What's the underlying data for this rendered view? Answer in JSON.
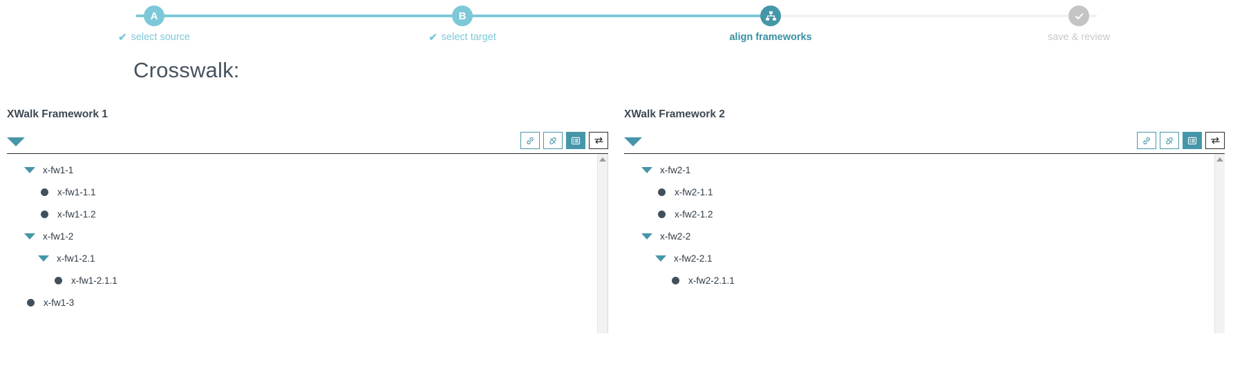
{
  "stepper": {
    "steps": [
      {
        "badge": "A",
        "label": "select source",
        "state": "done",
        "icon": "check-icon"
      },
      {
        "badge": "B",
        "label": "select target",
        "state": "done",
        "icon": "check-icon"
      },
      {
        "badge": "",
        "label": "align frameworks",
        "state": "active",
        "icon": "sitemap-icon"
      },
      {
        "badge": "",
        "label": "save & review",
        "state": "pending",
        "icon": "check-circle-icon"
      }
    ],
    "check_glyph": "✔",
    "colors": {
      "done": "#7dc8d8",
      "active": "#4596a8",
      "pending": "#c4c4c4",
      "track_todo": "#f2f2f2"
    }
  },
  "page_title": "Crosswalk:",
  "panels": [
    {
      "title": "XWalk Framework 1",
      "toolbar": {
        "buttons": [
          {
            "name": "link-button",
            "icon": "link-icon",
            "state": "default"
          },
          {
            "name": "unlink-button",
            "icon": "unlink-icon",
            "state": "default"
          },
          {
            "name": "list-view-button",
            "icon": "list-icon",
            "state": "active"
          },
          {
            "name": "swap-button",
            "icon": "exchange-arrows-icon",
            "state": "dark"
          }
        ]
      },
      "tree": [
        {
          "label": "x-fw1-1",
          "depth": 0,
          "type": "caret"
        },
        {
          "label": "x-fw1-1.1",
          "depth": 1,
          "type": "dot"
        },
        {
          "label": "x-fw1-1.2",
          "depth": 1,
          "type": "dot"
        },
        {
          "label": "x-fw1-2",
          "depth": 0,
          "type": "caret"
        },
        {
          "label": "x-fw1-2.1",
          "depth": 1,
          "type": "caret"
        },
        {
          "label": "x-fw1-2.1.1",
          "depth": 2,
          "type": "dot"
        },
        {
          "label": "x-fw1-3",
          "depth": -1,
          "type": "dot"
        }
      ]
    },
    {
      "title": "XWalk Framework 2",
      "toolbar": {
        "buttons": [
          {
            "name": "link-button",
            "icon": "link-icon",
            "state": "default"
          },
          {
            "name": "unlink-button",
            "icon": "unlink-icon",
            "state": "default"
          },
          {
            "name": "list-view-button",
            "icon": "list-icon",
            "state": "active"
          },
          {
            "name": "swap-button",
            "icon": "exchange-arrows-icon",
            "state": "dark"
          }
        ]
      },
      "tree": [
        {
          "label": "x-fw2-1",
          "depth": 0,
          "type": "caret"
        },
        {
          "label": "x-fw2-1.1",
          "depth": 1,
          "type": "dot"
        },
        {
          "label": "x-fw2-1.2",
          "depth": 1,
          "type": "dot"
        },
        {
          "label": "x-fw2-2",
          "depth": 0,
          "type": "caret"
        },
        {
          "label": "x-fw2-2.1",
          "depth": 1,
          "type": "caret"
        },
        {
          "label": "x-fw2-2.1.1",
          "depth": 2,
          "type": "dot"
        }
      ]
    }
  ]
}
